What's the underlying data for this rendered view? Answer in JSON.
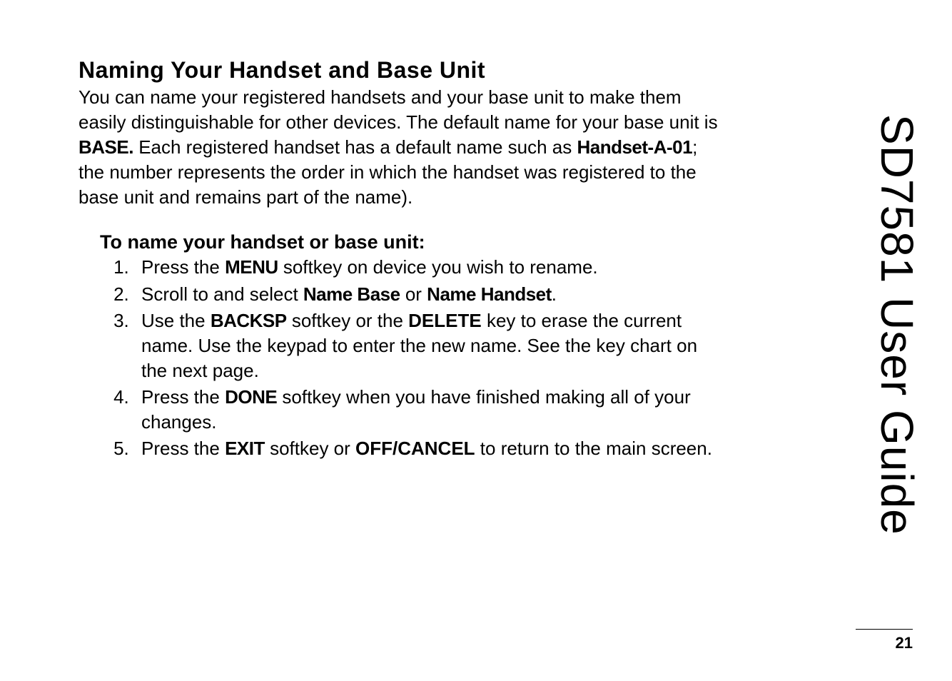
{
  "heading": "Naming Your Handset and Base Unit",
  "intro_parts": {
    "p1": "You can name your registered handsets and your base unit to make them easily distinguishable for other devices. The default name for your base unit is ",
    "base": "BASE.",
    "p2": " Each registered handset has a default name such as ",
    "handset": "Handset-A-01",
    "p3": "; the number represents the order in which the handset was registered to the base unit and remains part of the name)."
  },
  "subhead": "To name your handset or base unit:",
  "steps": {
    "s1a": "Press the ",
    "s1m": "MENU",
    "s1b": " softkey on device you wish to rename.",
    "s2a": "Scroll to and select ",
    "s2nb": "Name Base",
    "s2or": " or ",
    "s2nh": "Name Handset",
    "s2end": ".",
    "s3a": "Use the ",
    "s3bk": "BACKSP",
    "s3b": " softkey or the ",
    "s3del": "DELETE",
    "s3c": " key to erase the current name. Use the keypad to enter the new name. See the key chart on the next page.",
    "s4a": "Press the ",
    "s4d": "DONE",
    "s4b": " softkey when you have finished making all of your changes.",
    "s5a": "Press the ",
    "s5e": "EXIT",
    "s5b": " softkey or ",
    "s5oc": "OFF/CANCEL",
    "s5c": " to return to the main screen."
  },
  "side_title": "SD7581 User Guide",
  "page_number": "21"
}
